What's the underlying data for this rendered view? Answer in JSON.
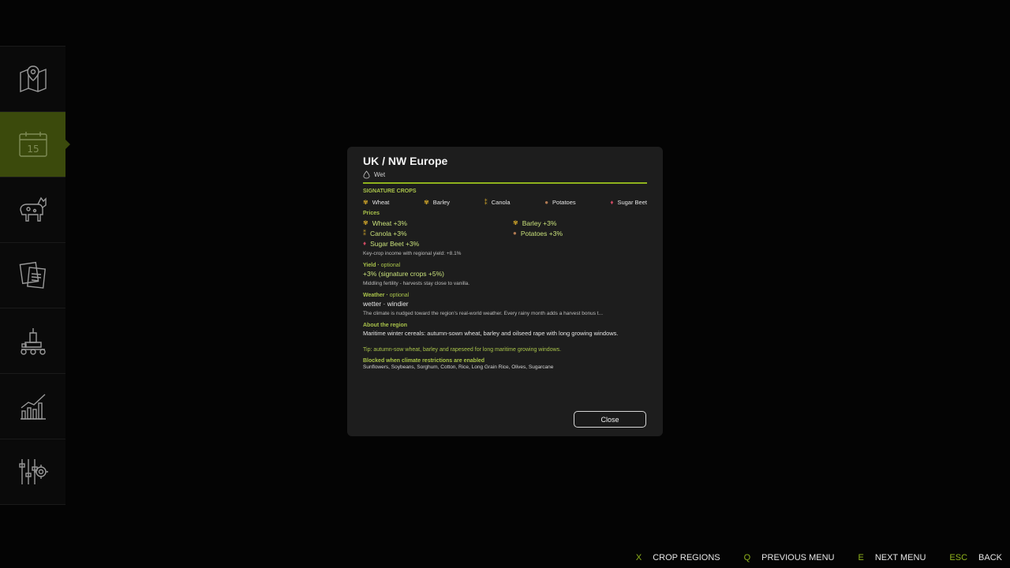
{
  "sidebar": {
    "items": [
      {
        "icon": "map-pin-icon",
        "active": false
      },
      {
        "icon": "calendar-icon",
        "active": true,
        "day": "15"
      },
      {
        "icon": "animals-icon",
        "active": false
      },
      {
        "icon": "contracts-icon",
        "active": false
      },
      {
        "icon": "production-icon",
        "active": false
      },
      {
        "icon": "statistics-icon",
        "active": false
      },
      {
        "icon": "settings-icon",
        "active": false
      }
    ]
  },
  "dialog": {
    "title": "UK / NW Europe",
    "climate": "Wet",
    "signature_crops_header": "SIGNATURE CROPS",
    "signature_crops": [
      {
        "name": "Wheat",
        "icon": "wheat-icon"
      },
      {
        "name": "Barley",
        "icon": "barley-icon"
      },
      {
        "name": "Canola",
        "icon": "canola-icon"
      },
      {
        "name": "Potatoes",
        "icon": "potato-icon"
      },
      {
        "name": "Sugar Beet",
        "icon": "sugar-beet-icon"
      }
    ],
    "prices_header": "Prices",
    "prices": [
      {
        "label": "Wheat +3%",
        "icon": "wheat-icon"
      },
      {
        "label": "Barley +3%",
        "icon": "barley-icon"
      },
      {
        "label": "Canola +3%",
        "icon": "canola-icon"
      },
      {
        "label": "Potatoes +3%",
        "icon": "potato-icon"
      },
      {
        "label": "Sugar Beet +3%",
        "icon": "sugar-beet-icon"
      }
    ],
    "key_crop_note": "Key-crop income with regional yield: +8.1%",
    "yield": {
      "header": "Yield",
      "optional": "optional",
      "value": "+3%  (signature crops +5%)",
      "note": "Middling fertility - harvests stay close to vanilla."
    },
    "weather": {
      "header": "Weather",
      "optional": "optional",
      "value": "wetter  ·  windier",
      "note": "The climate is nudged toward the region's real-world weather. Every rainy month adds a harvest bonus t..."
    },
    "about": {
      "header": "About the region",
      "text": "Maritime winter cereals: autumn-sown wheat, barley and oilseed rape with long growing windows."
    },
    "tip": "Tip: autumn-sow wheat, barley and rapeseed for long maritime growing windows.",
    "blocked": {
      "header": "Blocked when climate restrictions are enabled",
      "list": "Sunflowers, Soybeans, Sorghum, Cotton, Rice, Long Grain Rice, Olives, Sugarcane"
    },
    "close_label": "Close"
  },
  "hints": [
    {
      "key": "X",
      "label": "CROP REGIONS"
    },
    {
      "key": "Q",
      "label": "PREVIOUS MENU"
    },
    {
      "key": "E",
      "label": "NEXT MENU"
    },
    {
      "key": "ESC",
      "label": "BACK"
    }
  ],
  "colors": {
    "accent": "#8fb21d",
    "accent_text": "#a9c34a",
    "active_tab": "#3b4a0c",
    "dialog_bg": "#1d1d1d"
  }
}
